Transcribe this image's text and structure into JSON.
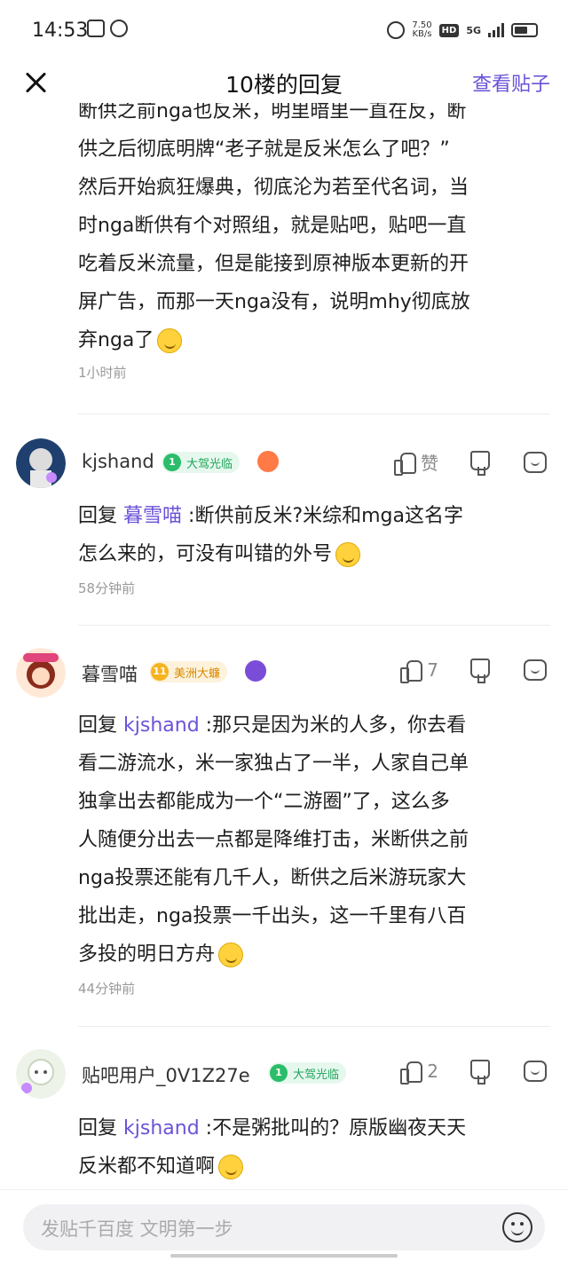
{
  "status_bar": {
    "time": "14:53",
    "speed_value": "7.50",
    "speed_unit": "KB/s",
    "hd": "HD",
    "network": "5G"
  },
  "header": {
    "title": "10楼的回复",
    "view_post": "查看贴子"
  },
  "first_comment": {
    "lines": [
      "断供之前nga也反米，明里暗里一直在反，断",
      "供之后彻底明牌“老子就是反米怎么了吧？”",
      "然后开始疯狂爆典，彻底沦为若至代名词，当",
      "时nga断供有个对照组，就是贴吧，贴吧一直",
      "吃着反米流量，但是能接到原神版本更新的开",
      "屏广告，而那一天nga没有，说明mhy彻底放",
      "弃nga了"
    ],
    "time": "1小时前"
  },
  "replies": [
    {
      "username": "kjshand",
      "level": "1",
      "badge": "大驾光临",
      "like_label": "赞",
      "reply_prefix": "回复",
      "mention": "暮雪喵",
      "lines": [
        ":断供前反米?米综和mga这名字",
        "怎么来的，可没有叫错的外号"
      ],
      "time": "58分钟前"
    },
    {
      "username": "暮雪喵",
      "level": "11",
      "badge": "美洲大蠊",
      "like_label": "7",
      "reply_prefix": "回复",
      "mention": "kjshand",
      "lines": [
        ":那只是因为米的人多，你去看",
        "看二游流水，米一家独占了一半，人家自己单",
        "独拿出去都能成为一个“二游圈”了，这么多",
        "人随便分出去一点都是降维打击，米断供之前",
        "nga投票还能有几千人，断供之后米游玩家大",
        "批出走，nga投票一千出头，这一千里有八百",
        "多投的明日方舟"
      ],
      "time": "44分钟前"
    },
    {
      "username": "贴吧用户_0V1Z27e",
      "level": "1",
      "badge": "大驾光临",
      "like_label": "2",
      "reply_prefix": "回复",
      "mention": "kjshand",
      "lines": [
        ":不是粥批叫的？原版幽夜天天",
        "反米都不知道啊"
      ]
    }
  ],
  "bottom_bar": {
    "placeholder": "发贴千百度 文明第一步"
  },
  "colors": {
    "accent": "#6b52d8",
    "badge_green": "#2bbd6a",
    "badge_gold": "#f5b31e",
    "muted": "#9a9a9a"
  }
}
